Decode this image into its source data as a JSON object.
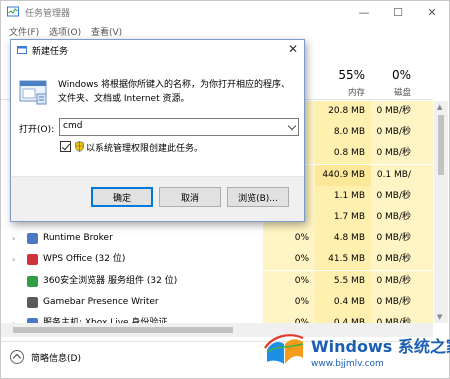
{
  "task_manager": {
    "title": "任务管理器",
    "menus": [
      "文件(F)",
      "选项(O)",
      "查看(V)"
    ],
    "columns": [
      {
        "percent": "55%",
        "label": "内存"
      },
      {
        "percent": "0%",
        "label": "磁盘"
      }
    ],
    "rows": [
      {
        "name": "",
        "cpu": "",
        "mem": "20.8 MB",
        "disk": "0 MB/秒",
        "net": "",
        "expand": false
      },
      {
        "name": "",
        "cpu": "",
        "mem": "8.0 MB",
        "disk": "0 MB/秒",
        "net": "",
        "expand": false
      },
      {
        "name": "",
        "cpu": "",
        "mem": "0.8 MB",
        "disk": "0 MB/秒",
        "net": "",
        "expand": false
      },
      {
        "name": "",
        "cpu": "",
        "mem": "440.9 MB",
        "disk": "0.1 MB/秒",
        "net": "",
        "expand": false
      },
      {
        "name": "",
        "cpu": "",
        "mem": "1.1 MB",
        "disk": "0 MB/秒",
        "net": "",
        "expand": false
      },
      {
        "name": "",
        "cpu": "",
        "mem": "1.7 MB",
        "disk": "0 MB/秒",
        "net": "",
        "expand": false
      },
      {
        "name": "Runtime Broker",
        "cpu": "0%",
        "mem": "4.8 MB",
        "disk": "0 MB/秒",
        "net": "",
        "expand": true
      },
      {
        "name": "WPS Office (32 位)",
        "cpu": "0%",
        "mem": "41.5 MB",
        "disk": "0 MB/秒",
        "net": "",
        "expand": true
      },
      {
        "name": "360安全浏览器 服务组件 (32 位)",
        "cpu": "0%",
        "mem": "5.5 MB",
        "disk": "0 MB/秒",
        "net": "",
        "expand": false
      },
      {
        "name": "Gamebar Presence Writer",
        "cpu": "0%",
        "mem": "0.4 MB",
        "disk": "0 MB/秒",
        "net": "",
        "expand": false
      },
      {
        "name": "服务主机: Xbox Live 身份验证...",
        "cpu": "0%",
        "mem": "0.4 MB",
        "disk": "0 MB/秒",
        "net": "",
        "expand": true
      }
    ],
    "fewer_details": "简略信息(D)"
  },
  "run_dialog": {
    "title": "新建任务",
    "description": "Windows 将根据你所键入的名称，为你打开相应的程序、文件夹、文档或 Internet 资源。",
    "open_label": "打开(O):",
    "input_value": "cmd",
    "admin_checkbox_label": "以系统管理权限创建此任务。",
    "admin_checked": true,
    "ok_label": "确定",
    "cancel_label": "取消",
    "browse_label": "浏览(B)..."
  },
  "watermark": {
    "brand": "Windows 系统之家",
    "url": "www.bjjmlv.com"
  },
  "colors": {
    "accent": "#0078d7",
    "heat_light": "#fff4c4",
    "heat_mid": "#fff0b0",
    "watermark_blue": "#1a5fb4"
  }
}
